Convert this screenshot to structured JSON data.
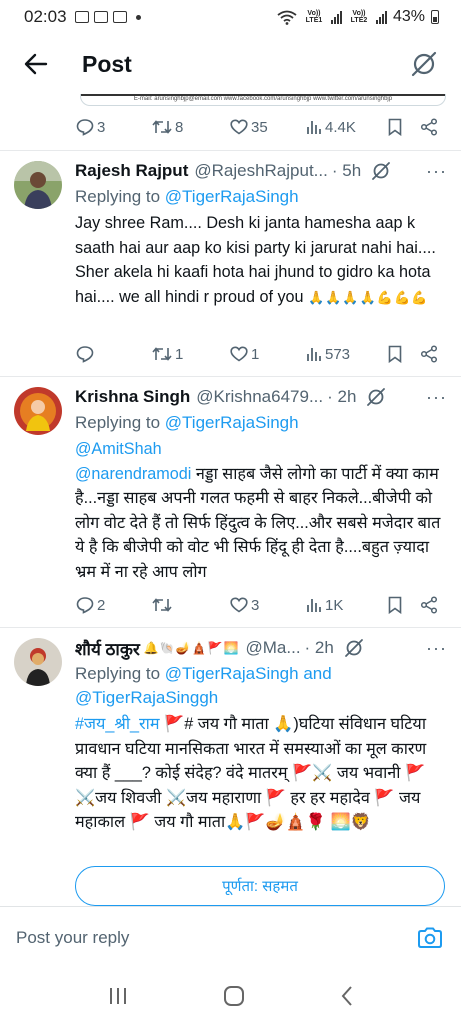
{
  "status": {
    "time": "02:03",
    "lte1": "Vo)) LTE1",
    "lte2": "Vo)) LTE2",
    "battery": "43%"
  },
  "header": {
    "title": "Post"
  },
  "previous_post": {
    "card_text": "E-mail: arunsinghbjp@email.com  www.facebook.com/arunsinghbjp  www.twitter.com/arunsinghbjp",
    "replies": "3",
    "reposts": "8",
    "likes": "35",
    "views": "4.4K"
  },
  "replies": [
    {
      "name": "Rajesh Rajput",
      "handle": "@RajeshRajput...",
      "time": "· 5h",
      "replying_prefix": "Replying to ",
      "replying_to": "@TigerRajaSingh",
      "text": "Jay shree Ram.... Desh ki janta hamesha aap k saath hai aur aap ko kisi party ki jarurat nahi hai.... Sher akela hi kaafi hota hai jhund to gidro ka hota hai.... we all hindi r proud of you",
      "emoji": "🙏🙏🙏🙏💪💪💪",
      "stats": {
        "replies": "",
        "reposts": "1",
        "likes": "1",
        "views": "573"
      }
    },
    {
      "name": "Krishna Singh",
      "handle": "@Krishna6479...",
      "time": "· 2h",
      "replying_prefix": "Replying to ",
      "replying_to": "@TigerRajaSingh",
      "mention1": "@AmitShah",
      "mention2": "@narendramodi",
      "text": "नड्डा साहब जैसे लोगो का पार्टी में क्या काम है...नड्डा साहब अपनी गलत फहमी से बाहर निकले...बीजेपी को लोग वोट देते हैं तो सिर्फ हिंदुत्व के लिए...और सबसे मजेदार बात ये है कि बीजेपी को वोट भी सिर्फ हिंदू ही देता है....बहुत ज़्यादा भ्रम में ना रहे आप लोग",
      "stats": {
        "replies": "2",
        "reposts": "",
        "likes": "3",
        "views": "1K"
      }
    },
    {
      "name": "शौर्य ठाकुर",
      "name_emoji": "🔔🐚🪔🛕🚩🌅",
      "handle": "@Ma...",
      "time": "· 2h",
      "replying_prefix": "Replying to ",
      "replying_to": "@TigerRajaSingh",
      "replying_and": " and",
      "replying_to2": "@TigerRajaSinggh",
      "hashtag": "#जय_श्री_राम",
      "text": " 🚩# जय गौ माता 🙏)घटिया संविधान घटिया प्रावधान घटिया मानसिकता भारत में समस्याओं का मूल कारण क्या हैं ___?  कोई संदेह? वंदे मातरम् 🚩⚔️ जय भवानी 🚩 ⚔️जय शिवजी ⚔️जय महाराणा 🚩 हर हर महादेव 🚩 जय महाकाल 🚩 जय गौ माता🙏🚩🪔🛕🌹 🌅🦁",
      "translate": "पूर्णता: सहमत"
    }
  ],
  "reply_bar": {
    "placeholder": "Post your reply"
  },
  "colors": {
    "accent": "#1d9bf0",
    "muted": "#536471",
    "text": "#0f1419"
  }
}
